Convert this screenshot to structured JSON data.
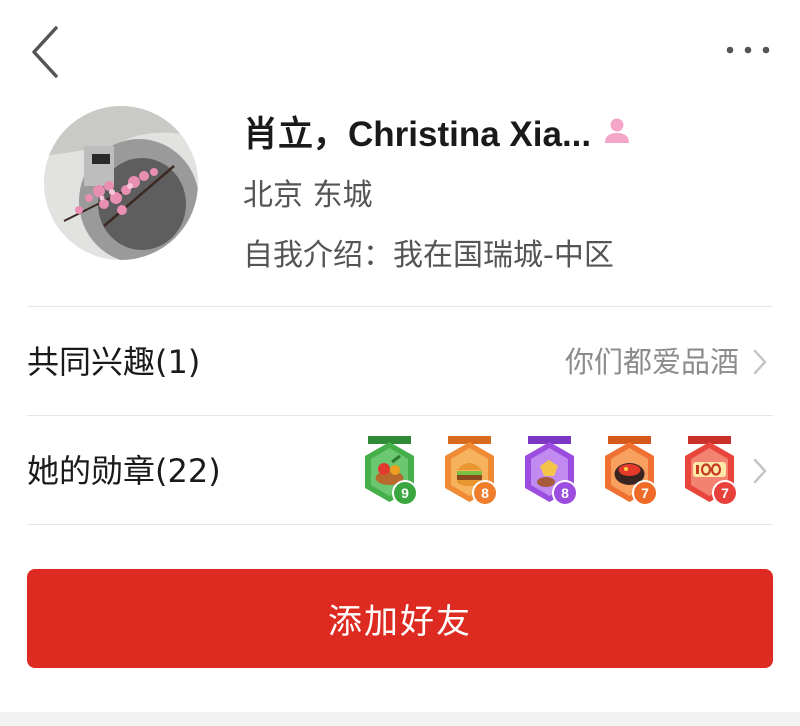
{
  "header": {
    "back_icon": "chevron-left-icon",
    "more_icon": "more-dots-icon"
  },
  "profile": {
    "name": "肖立，Christina Xia...",
    "gender_icon": "female-person-icon",
    "gender_color": "#f5a6c8",
    "location": "北京 东城",
    "bio": "自我介绍：我在国瑞城-中区"
  },
  "interests": {
    "label": "共同兴趣(1)",
    "value": "你们都爱品酒"
  },
  "medals": {
    "label": "她的勋章(22)",
    "badges": [
      {
        "icon": "vegetable-basket-icon",
        "count": "9",
        "color": "#3aa63f"
      },
      {
        "icon": "burger-icon",
        "count": "8",
        "color": "#ef7d2b"
      },
      {
        "icon": "sweet-potato-icon",
        "count": "8",
        "color": "#9b4de0"
      },
      {
        "icon": "volcano-icon",
        "count": "7",
        "color": "#ef6b27"
      },
      {
        "icon": "hundred-points-icon",
        "count": "7",
        "color": "#e8403a"
      }
    ]
  },
  "actions": {
    "add_friend": "添加好友",
    "accent": "#dd2b22"
  }
}
